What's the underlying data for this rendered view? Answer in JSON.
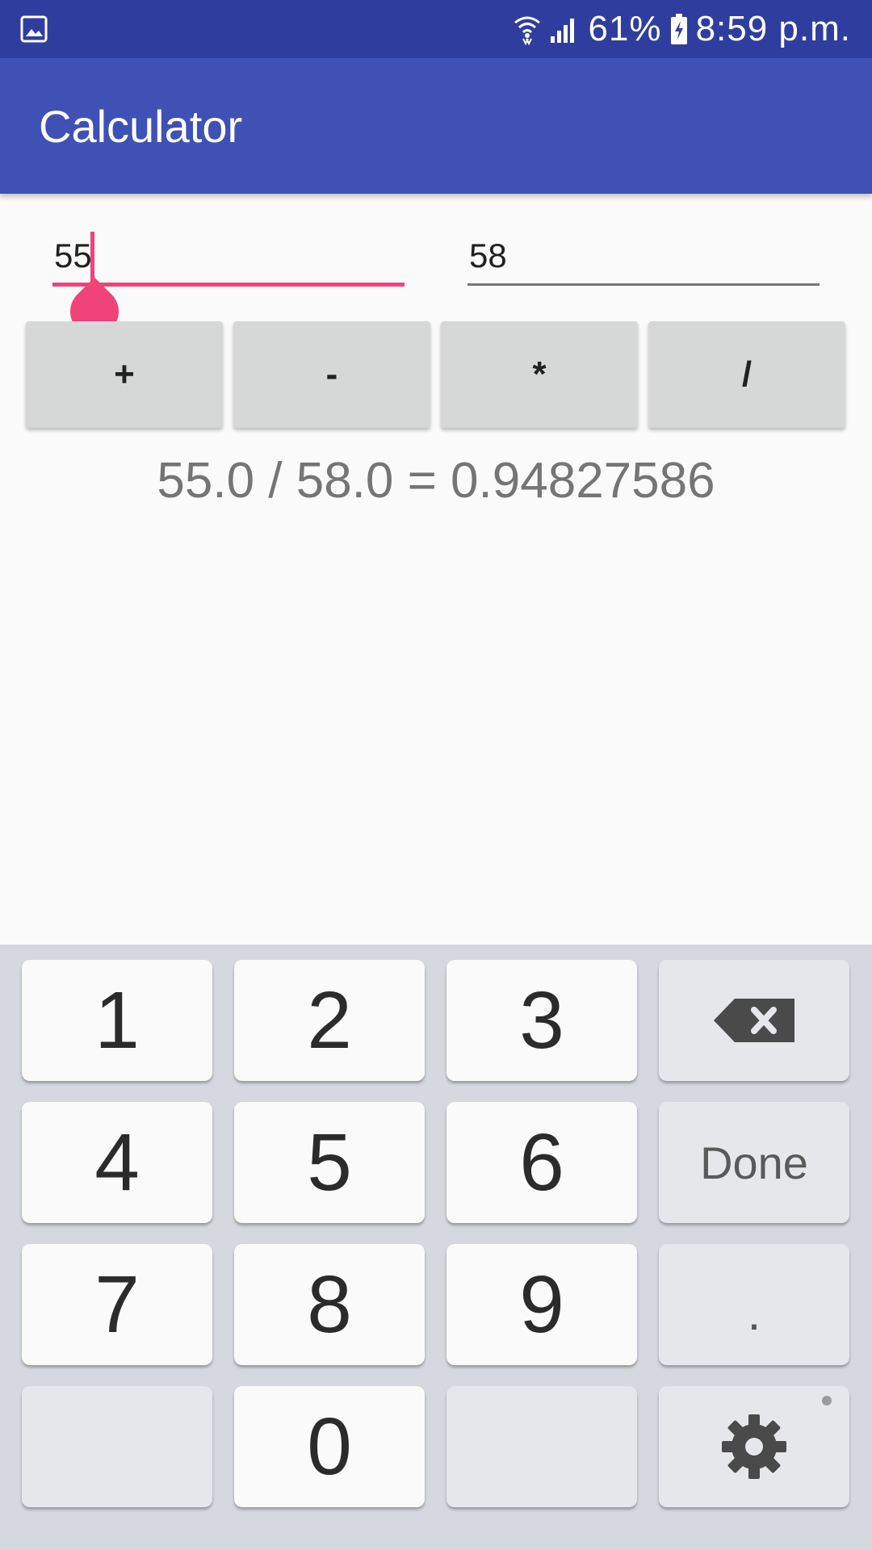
{
  "status_bar": {
    "battery": "61%",
    "time": "8:59 p.m.",
    "icons": [
      "gallery-icon",
      "wifi-icon",
      "signal-icon",
      "battery-charging-icon"
    ]
  },
  "app": {
    "title": "Calculator",
    "colors": {
      "status_bar": "#2f3e9e",
      "app_bar": "#3f51b5",
      "accent": "#f0437a"
    }
  },
  "inputs": {
    "first_value": "55",
    "second_value": "58"
  },
  "operators": [
    "+",
    "-",
    "*",
    "/"
  ],
  "result": "55.0 / 58.0 = 0.94827586",
  "keyboard": {
    "digits": {
      "k1": "1",
      "k2": "2",
      "k3": "3",
      "k4": "4",
      "k5": "5",
      "k6": "6",
      "k7": "7",
      "k8": "8",
      "k9": "9",
      "k0": "0"
    },
    "done_label": "Done",
    "dot_label": ".",
    "backspace_icon": "backspace-icon",
    "settings_icon": "gear-icon"
  }
}
